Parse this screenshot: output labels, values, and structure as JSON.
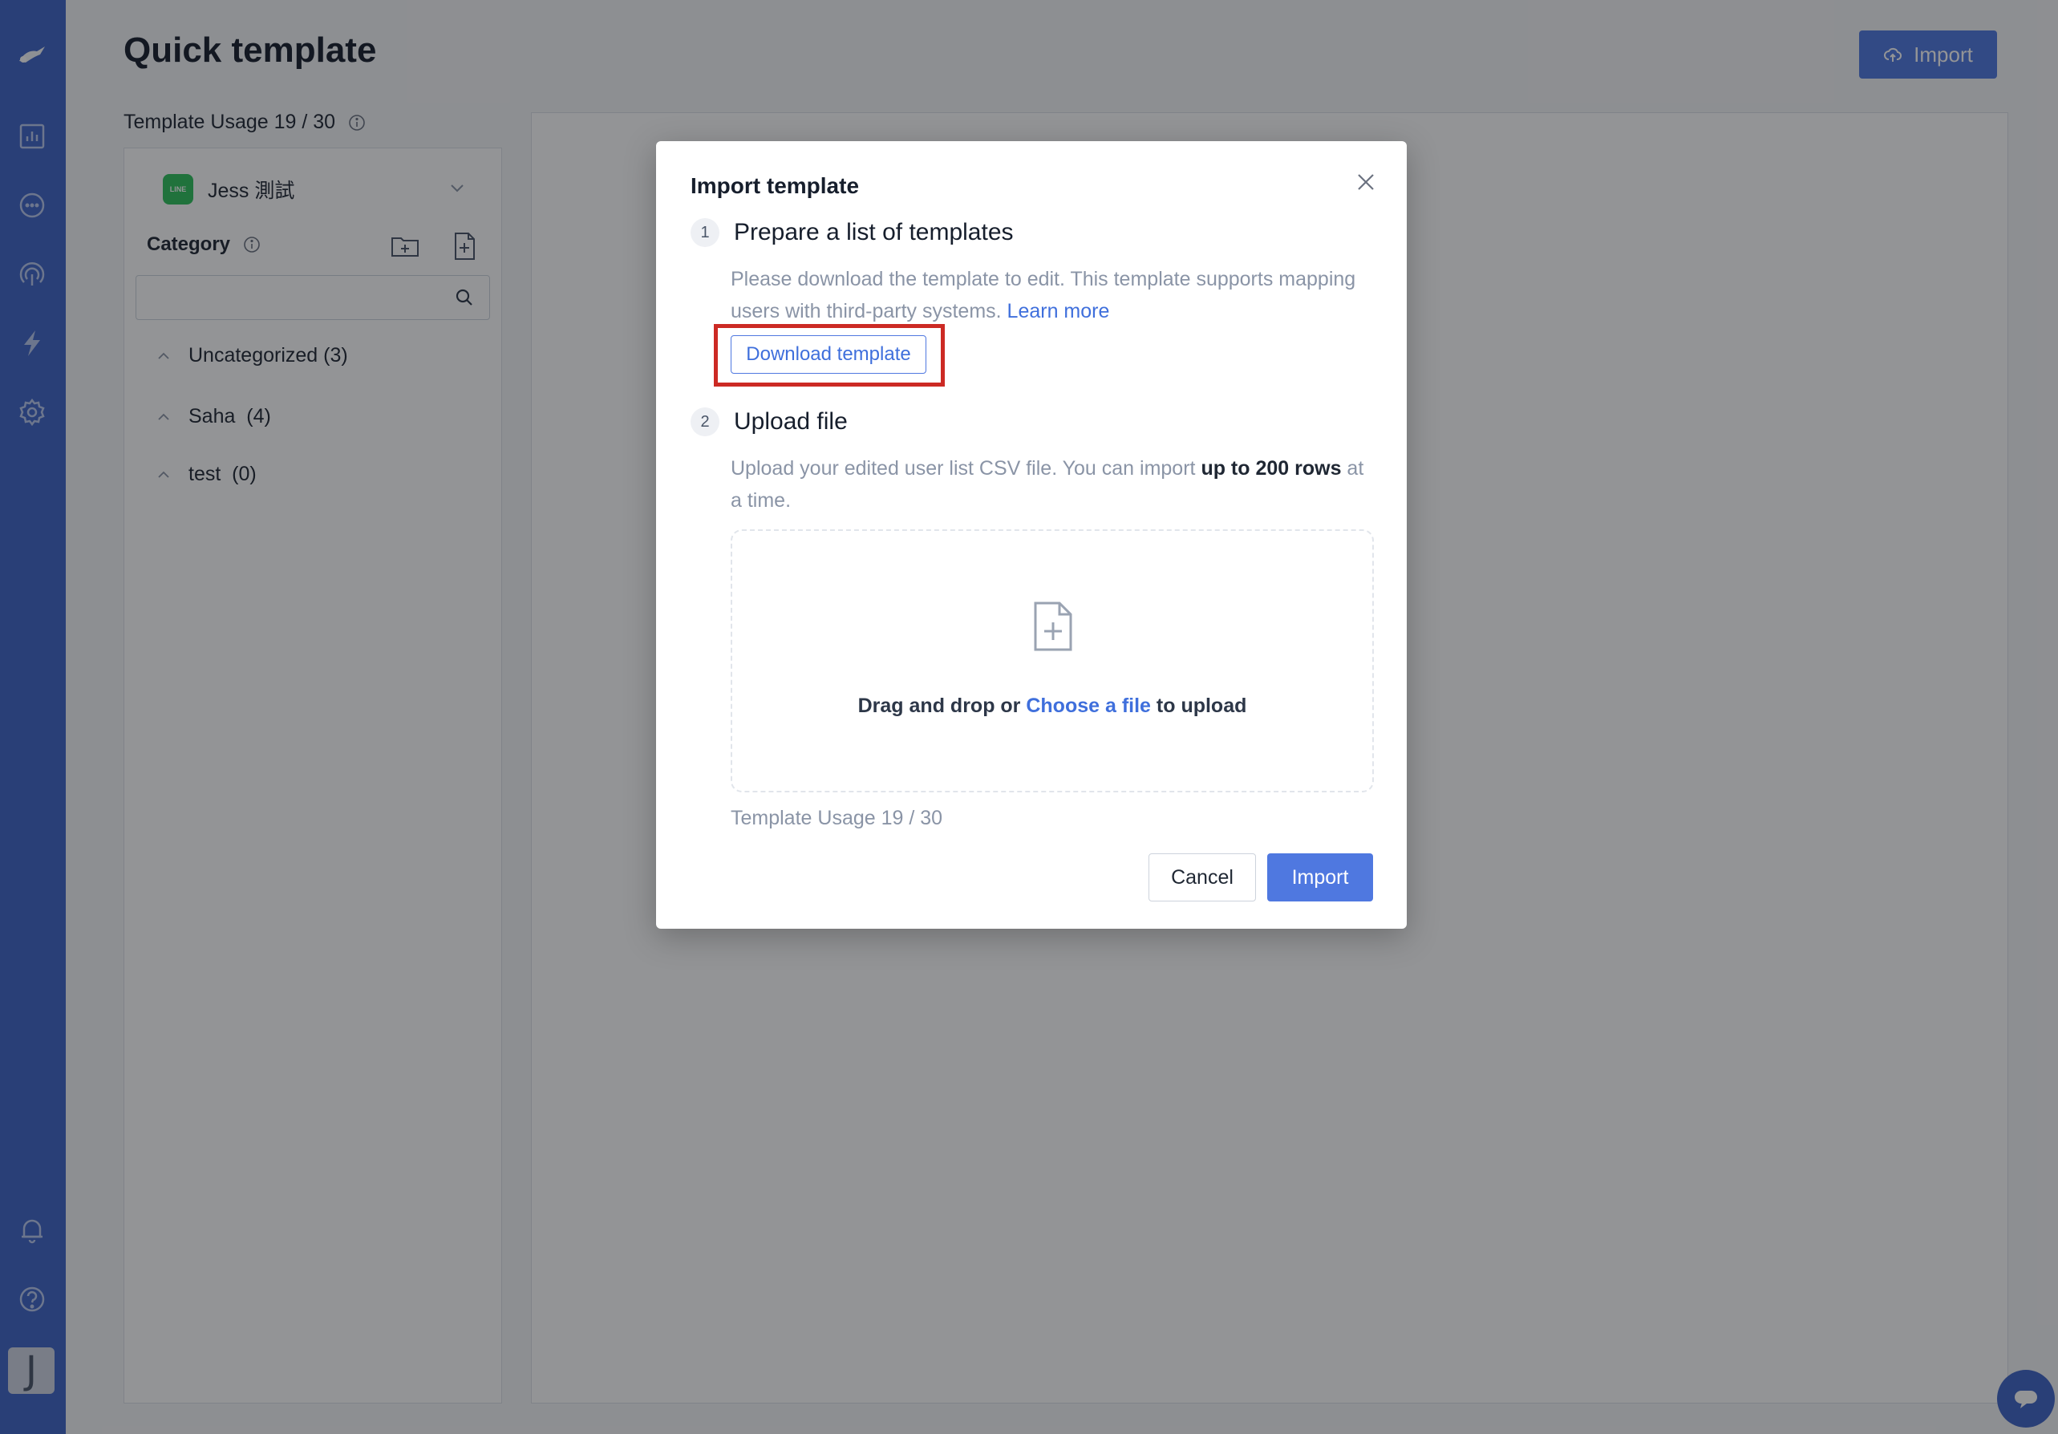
{
  "colors": {
    "sidebar": "#3f64c6",
    "accent": "#4f78e0",
    "link": "#3f6fdc",
    "highlight": "#cc2a24",
    "line_green": "#2ec15c"
  },
  "sidebar": {
    "icons": [
      "logo-icon",
      "analytics-icon",
      "chat-icon",
      "broadcast-icon",
      "automation-icon",
      "settings-icon",
      "bell-icon",
      "help-icon"
    ],
    "avatar": "J"
  },
  "page": {
    "title": "Quick template",
    "import_button": "Import",
    "usage": "Template Usage 19 / 30"
  },
  "left_panel": {
    "channel_name": "Jess 測試",
    "category_label": "Category",
    "search_placeholder": "",
    "categories": [
      {
        "label": "Uncategorized (3)"
      },
      {
        "label": "Saha  (4)"
      },
      {
        "label": "test  (0)"
      }
    ]
  },
  "modal": {
    "title": "Import template",
    "step1": {
      "number": "1",
      "title": "Prepare a list of templates",
      "desc": "Please download the template to edit. This template supports mapping users with third-party systems.",
      "learn_more": "Learn more",
      "download_button": "Download template"
    },
    "step2": {
      "number": "2",
      "title": "Upload file",
      "desc_before": "Upload your edited user list CSV file. You can import ",
      "desc_bold": "up to 200 rows",
      "desc_after": " at a time.",
      "drop_before": "Drag and drop or ",
      "drop_link": "Choose a file",
      "drop_after": " to upload"
    },
    "usage": "Template Usage 19 / 30",
    "cancel": "Cancel",
    "import": "Import"
  }
}
